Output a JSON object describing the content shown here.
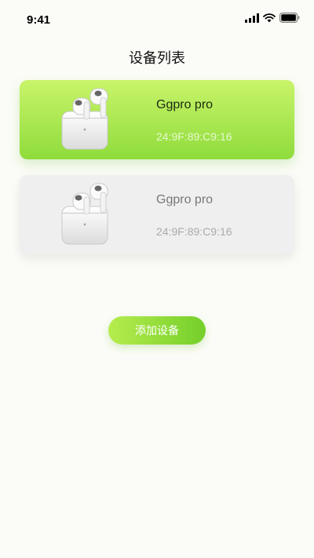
{
  "status_bar": {
    "time": "9:41",
    "icons": [
      "signal-icon",
      "wifi-icon",
      "battery-icon"
    ]
  },
  "header": {
    "title": "设备列表"
  },
  "devices": [
    {
      "name": "Ggpro pro",
      "mac": "24:9F:89:C9:16",
      "state": "selected",
      "image": "airpods-case-icon"
    },
    {
      "name": "Ggpro pro",
      "mac": "24:9F:89:C9:16",
      "state": "unselected",
      "image": "airpods-case-icon"
    }
  ],
  "actions": {
    "add_device_label": "添加设备"
  },
  "colors": {
    "accent_start": "#c9f46a",
    "accent_end": "#8fdc3c",
    "background": "#fbfcf7",
    "inactive_card": "#efefef"
  }
}
